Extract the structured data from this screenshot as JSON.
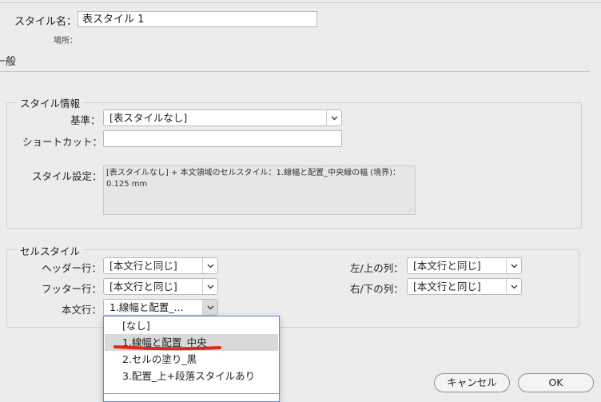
{
  "header": {
    "style_name_label": "スタイル名：",
    "style_name_value": "表スタイル 1",
    "location_label": "場所："
  },
  "section_title": "一般",
  "style_info": {
    "group_title": "スタイル情報",
    "based_on_label": "基準：",
    "based_on_value": "[表スタイルなし]",
    "shortcut_label": "ショートカット：",
    "shortcut_value": "",
    "settings_label": "スタイル設定：",
    "settings_text": "[表スタイルなし] + 本文領域のセルスタイル：1.線幅と配置_中央線の幅 (境界)：0.125 mm"
  },
  "cell_styles": {
    "group_title": "セルスタイル",
    "header_rows_label": "ヘッダー行：",
    "header_rows_value": "[本文行と同じ]",
    "footer_rows_label": "フッター行：",
    "footer_rows_value": "[本文行と同じ]",
    "body_rows_label": "本文行：",
    "body_rows_value": "1.線幅と配置_...",
    "left_top_label": "左/上の列：",
    "left_top_value": "[本文行と同じ]",
    "right_bottom_label": "右/下の列：",
    "right_bottom_value": "[本文行と同じ]"
  },
  "dropdown": {
    "items": [
      "[なし]",
      "1.線幅と配置_中央",
      "2.セルの塗り_黒",
      "3.配置_上+段落スタイルあり"
    ],
    "highlighted_index": 1,
    "annotation_color": "#e0281c"
  },
  "buttons": {
    "cancel": "キャンセル",
    "ok": "OK"
  }
}
